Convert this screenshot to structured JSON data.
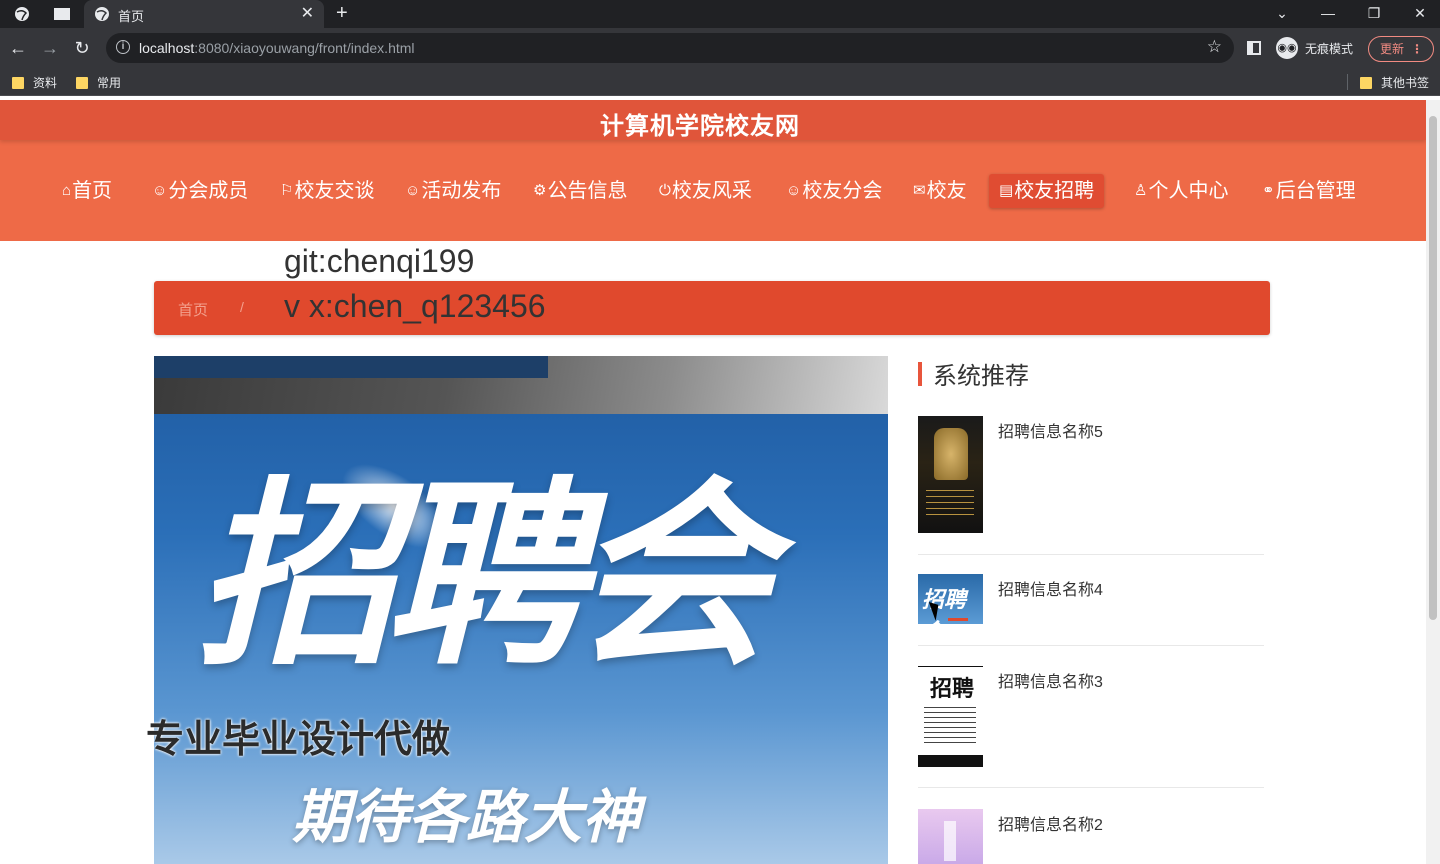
{
  "browser": {
    "tab_title": "首页",
    "url_host": "localhost",
    "url_rest": ":8080/xiaoyouwang/front/index.html",
    "incognito_label": "无痕模式",
    "update_label": "更新",
    "bookmarks": [
      "资料",
      "常用"
    ],
    "other_bookmarks": "其他书签"
  },
  "site": {
    "title": "计算机学院校友网",
    "nav": [
      {
        "icon": "⌂",
        "label": "首页"
      },
      {
        "icon": "☺",
        "label": "分会成员"
      },
      {
        "icon": "⚐",
        "label": "校友交谈"
      },
      {
        "icon": "☺",
        "label": "活动发布"
      },
      {
        "icon": "⚙",
        "label": "公告信息"
      },
      {
        "icon": "⏻",
        "label": "校友风采"
      },
      {
        "icon": "☺",
        "label": "校友分会"
      },
      {
        "icon": "✉",
        "label": "校友"
      },
      {
        "icon": "▤",
        "label": "校友招聘"
      },
      {
        "icon": "♙",
        "label": "个人中心"
      },
      {
        "icon": "⚭",
        "label": "后台管理"
      }
    ],
    "active_nav": "校友招聘"
  },
  "breadcrumb": {
    "home": "首页",
    "separator": "/"
  },
  "watermark": {
    "line1": "git:chenqi199",
    "line2": "v x:chen_q123456",
    "line3": "专业毕业设计代做"
  },
  "poster": {
    "title": "招聘会",
    "subtitle": "期待各路大神"
  },
  "recommend": {
    "title": "系统推荐",
    "items": [
      {
        "name": "招聘信息名称5"
      },
      {
        "name": "招聘信息名称4"
      },
      {
        "name": "招聘信息名称3"
      },
      {
        "name": "招聘信息名称2"
      }
    ]
  },
  "thumb_text": {
    "t4": "招聘会",
    "t3": "招聘"
  },
  "colors": {
    "header": "#ee6a47",
    "title_bar": "#e0553a",
    "breadcrumb": "#e0492d",
    "accent": "#e8553c"
  }
}
